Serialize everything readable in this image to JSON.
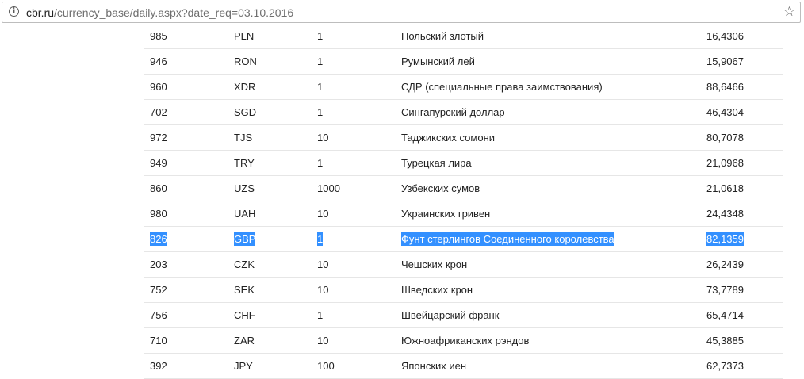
{
  "browser": {
    "url_host": "cbr.ru",
    "url_path": "/currency_base/daily.aspx?date_req=03.10.2016",
    "info_icon": "info-icon",
    "bookmark_icon": "star-icon"
  },
  "table": {
    "rows": [
      {
        "code": "985",
        "letter": "PLN",
        "units": "1",
        "name": "Польский злотый",
        "rate": "16,4306",
        "selected": false
      },
      {
        "code": "946",
        "letter": "RON",
        "units": "1",
        "name": "Румынский лей",
        "rate": "15,9067",
        "selected": false
      },
      {
        "code": "960",
        "letter": "XDR",
        "units": "1",
        "name": "СДР (специальные права заимствования)",
        "rate": "88,6466",
        "selected": false
      },
      {
        "code": "702",
        "letter": "SGD",
        "units": "1",
        "name": "Сингапурский доллар",
        "rate": "46,4304",
        "selected": false
      },
      {
        "code": "972",
        "letter": "TJS",
        "units": "10",
        "name": "Таджикских сомони",
        "rate": "80,7078",
        "selected": false
      },
      {
        "code": "949",
        "letter": "TRY",
        "units": "1",
        "name": "Турецкая лира",
        "rate": "21,0968",
        "selected": false
      },
      {
        "code": "860",
        "letter": "UZS",
        "units": "1000",
        "name": "Узбекских сумов",
        "rate": "21,0618",
        "selected": false
      },
      {
        "code": "980",
        "letter": "UAH",
        "units": "10",
        "name": "Украинских гривен",
        "rate": "24,4348",
        "selected": false
      },
      {
        "code": "826",
        "letter": "GBP",
        "units": "1",
        "name": "Фунт стерлингов Соединенного королевства",
        "rate": "82,1359",
        "selected": true
      },
      {
        "code": "203",
        "letter": "CZK",
        "units": "10",
        "name": "Чешских крон",
        "rate": "26,2439",
        "selected": false
      },
      {
        "code": "752",
        "letter": "SEK",
        "units": "10",
        "name": "Шведских крон",
        "rate": "73,7789",
        "selected": false
      },
      {
        "code": "756",
        "letter": "CHF",
        "units": "1",
        "name": "Швейцарский франк",
        "rate": "65,4714",
        "selected": false
      },
      {
        "code": "710",
        "letter": "ZAR",
        "units": "10",
        "name": "Южноафриканских рэндов",
        "rate": "45,3885",
        "selected": false
      },
      {
        "code": "392",
        "letter": "JPY",
        "units": "100",
        "name": "Японских иен",
        "rate": "62,7373",
        "selected": false
      }
    ]
  },
  "colors": {
    "selection": "#3390ff",
    "text": "#222222",
    "row_border": "#e6e6e6"
  }
}
